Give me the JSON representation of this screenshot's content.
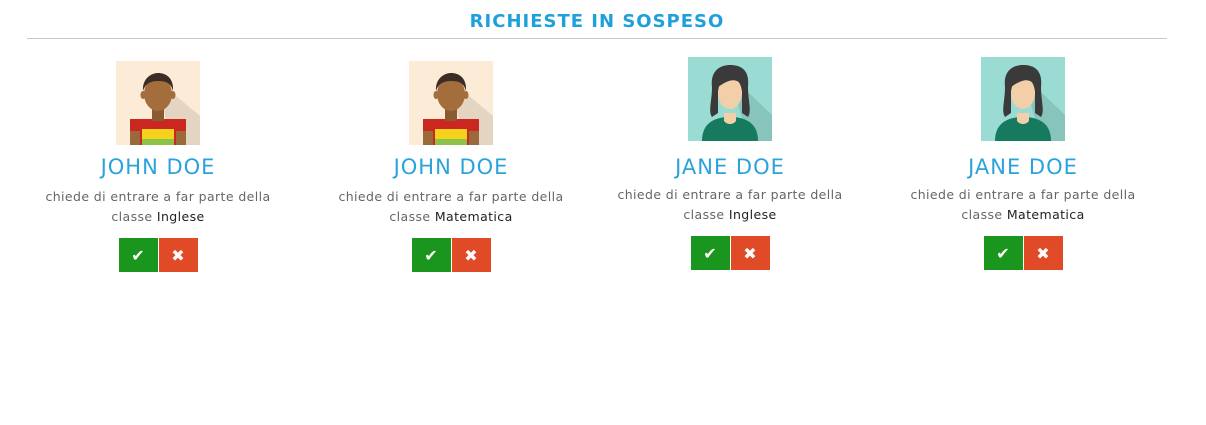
{
  "header": {
    "title": "RICHIESTE IN SOSPESO"
  },
  "requests": [
    {
      "name": "JOHN DOE",
      "desc_line1": "chiede di entrare a far parte della",
      "desc_prefix": "classe",
      "class_name": "Inglese",
      "avatar": "male-avatar-icon",
      "accept_icon": "✔",
      "reject_icon": "✖"
    },
    {
      "name": "JOHN DOE",
      "desc_line1": "chiede di entrare a far parte della",
      "desc_prefix": "classe",
      "class_name": "Matematica",
      "avatar": "male-avatar-icon",
      "accept_icon": "✔",
      "reject_icon": "✖"
    },
    {
      "name": "JANE DOE",
      "desc_line1": "chiede di entrare a far parte della",
      "desc_prefix": "classe",
      "class_name": "Inglese",
      "avatar": "female-avatar-icon",
      "accept_icon": "✔",
      "reject_icon": "✖"
    },
    {
      "name": "JANE DOE",
      "desc_line1": "chiede di entrare a far parte della",
      "desc_prefix": "classe",
      "class_name": "Matematica",
      "avatar": "female-avatar-icon",
      "accept_icon": "✔",
      "reject_icon": "✖"
    }
  ],
  "colors": {
    "accent": "#1ea0dc",
    "accept": "#1a951e",
    "reject": "#e04a27"
  }
}
